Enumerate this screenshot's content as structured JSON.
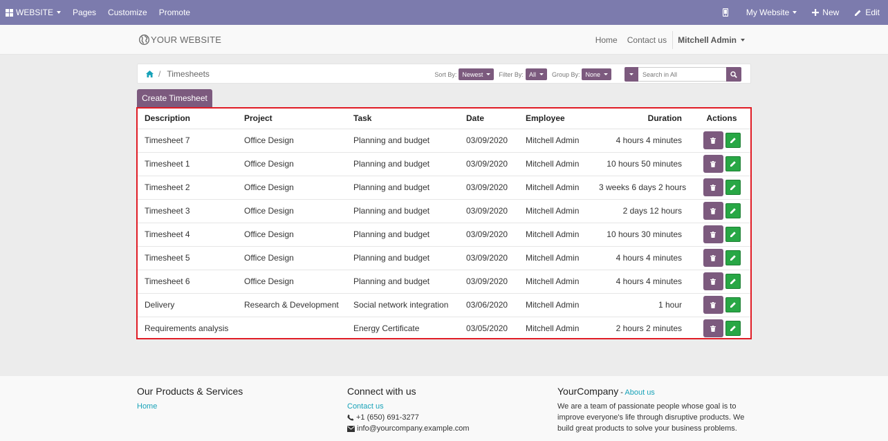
{
  "topbar": {
    "website_label": "WEBSITE",
    "pages_label": "Pages",
    "customize_label": "Customize",
    "promote_label": "Promote",
    "site_selector_label": "My Website",
    "new_label": "New",
    "edit_label": "Edit"
  },
  "header": {
    "logo_text": "YOUR WEBSITE",
    "nav": {
      "home": "Home",
      "contact": "Contact us",
      "user": "Mitchell Admin"
    }
  },
  "breadcrumb": {
    "current": "Timesheets"
  },
  "controls": {
    "sort_label": "Sort By:",
    "sort_value": "Newest",
    "filter_label": "Filter By:",
    "filter_value": "All",
    "group_label": "Group By:",
    "group_value": "None",
    "search_placeholder": "Search in All"
  },
  "create_button_label": "Create Timesheet",
  "table": {
    "headers": [
      "Description",
      "Project",
      "Task",
      "Date",
      "Employee",
      "Duration",
      "Actions"
    ],
    "rows": [
      [
        "Timesheet 7",
        "Office Design",
        "Planning and budget",
        "03/09/2020",
        "Mitchell Admin",
        "4 hours 4 minutes"
      ],
      [
        "Timesheet 1",
        "Office Design",
        "Planning and budget",
        "03/09/2020",
        "Mitchell Admin",
        "10 hours 50 minutes"
      ],
      [
        "Timesheet 2",
        "Office Design",
        "Planning and budget",
        "03/09/2020",
        "Mitchell Admin",
        "3 weeks 6 days 2 hours"
      ],
      [
        "Timesheet 3",
        "Office Design",
        "Planning and budget",
        "03/09/2020",
        "Mitchell Admin",
        "2 days 12 hours"
      ],
      [
        "Timesheet 4",
        "Office Design",
        "Planning and budget",
        "03/09/2020",
        "Mitchell Admin",
        "10 hours 30 minutes"
      ],
      [
        "Timesheet 5",
        "Office Design",
        "Planning and budget",
        "03/09/2020",
        "Mitchell Admin",
        "4 hours 4 minutes"
      ],
      [
        "Timesheet 6",
        "Office Design",
        "Planning and budget",
        "03/09/2020",
        "Mitchell Admin",
        "4 hours 4 minutes"
      ],
      [
        "Delivery",
        "Research & Development",
        "Social network integration",
        "03/06/2020",
        "Mitchell Admin",
        "1 hour"
      ],
      [
        "Requirements analysis",
        "",
        "Energy Certificate",
        "03/05/2020",
        "Mitchell Admin",
        "2 hours 2 minutes"
      ]
    ]
  },
  "footer": {
    "col1": {
      "title": "Our Products & Services",
      "link": "Home"
    },
    "col2": {
      "title": "Connect with us",
      "link": "Contact us",
      "phone": "+1 (650) 691-3277",
      "email": "info@yourcompany.example.com"
    },
    "col3": {
      "title": "YourCompany",
      "dash": " - ",
      "about": "About us",
      "text": "We are a team of passionate people whose goal is to improve everyone's life through disruptive products. We build great products to solve your business problems."
    }
  },
  "colors": {
    "topbar": "#7c7bad",
    "primary": "#7c5a7e",
    "edit_button": "#28a745",
    "highlight_border": "#e01b24",
    "link": "#17a2b8"
  },
  "icons": [
    "apps-grid-icon",
    "mobile-icon",
    "plus-icon",
    "pencil-icon",
    "globe-icon",
    "home-icon",
    "search-icon",
    "trash-icon",
    "phone-icon",
    "envelope-icon"
  ]
}
